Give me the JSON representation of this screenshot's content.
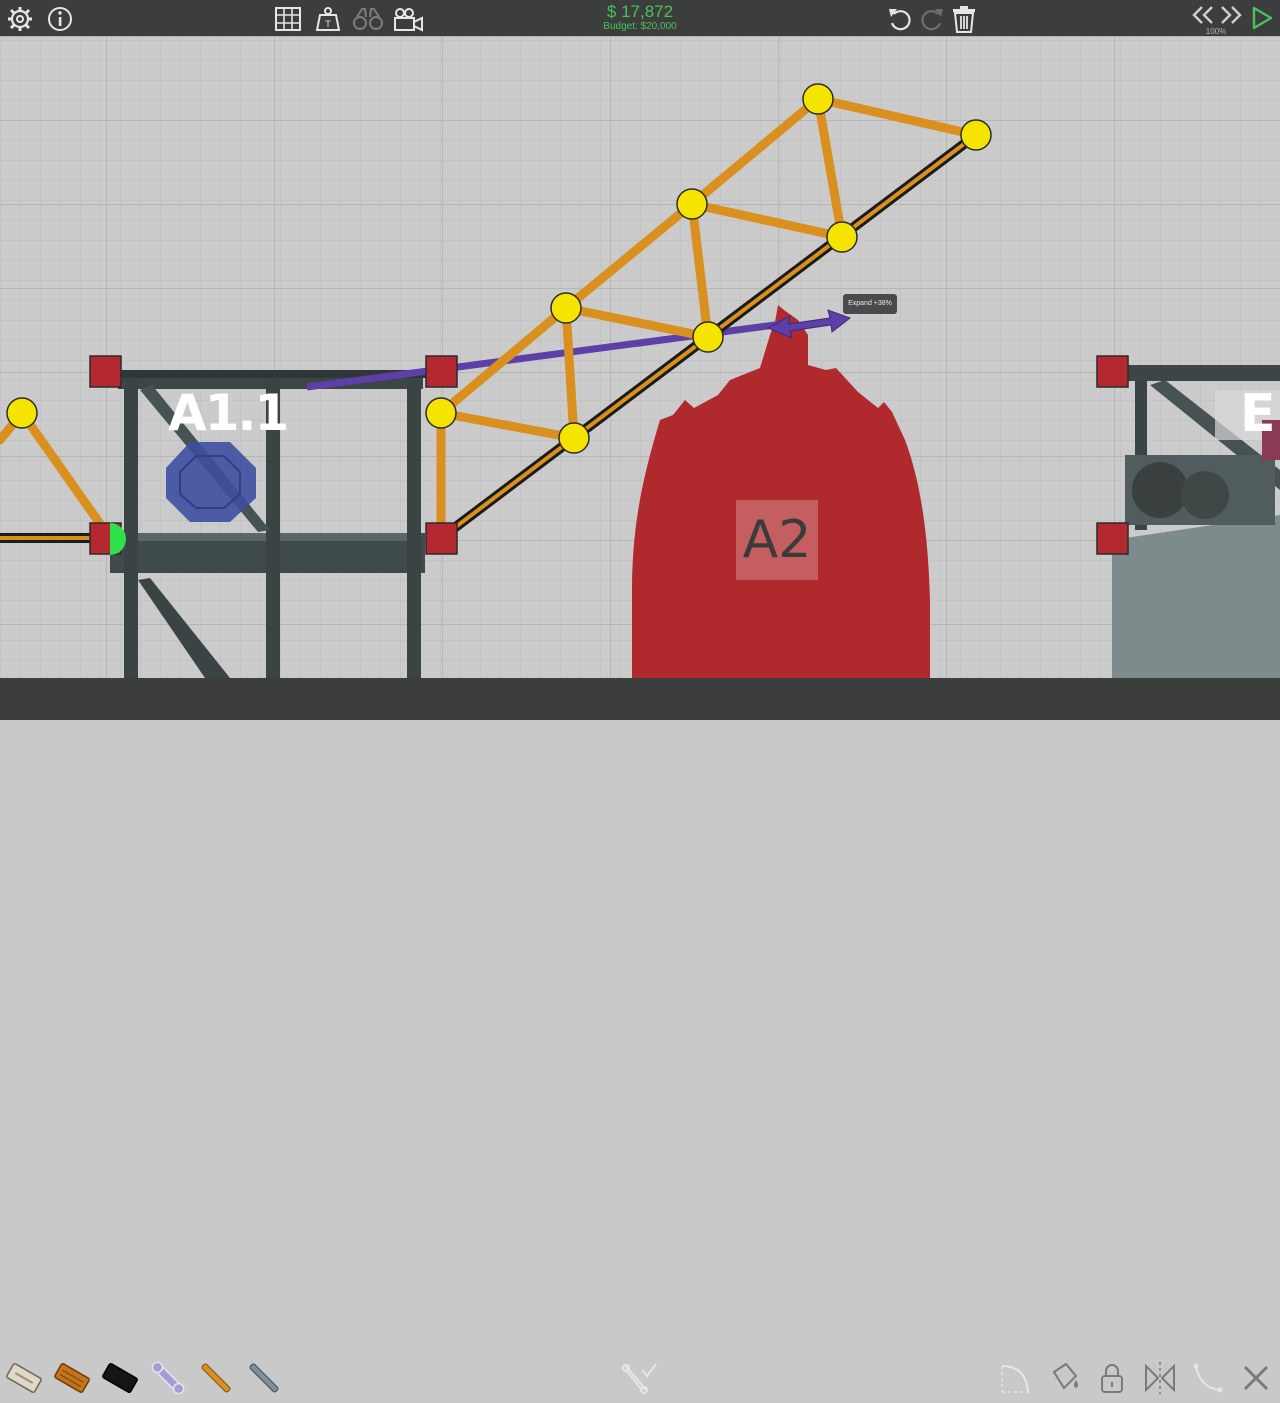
{
  "budget": {
    "cash": "$ 17,872",
    "limit": "Budget: $20,000"
  },
  "speed": {
    "label": "100%"
  },
  "zones": {
    "a11": "A1.1",
    "a2": "A2",
    "e": "E"
  },
  "tooltip": {
    "text": "Expand +38%"
  },
  "toolbar_top": {
    "left": [
      "settings-icon",
      "info-icon"
    ],
    "center": [
      "grid-icon",
      "weight-icon",
      "binoculars-icon",
      "camera-icon"
    ],
    "right": [
      "undo-icon",
      "redo-icon",
      "trash-icon",
      "rewind-icon",
      "fast-forward-icon",
      "play-icon"
    ]
  },
  "materials": [
    "road",
    "reinforced-road",
    "wood",
    "steel",
    "hydraulic",
    "rope",
    "cable"
  ],
  "bottom_right_tools": [
    "spline-icon",
    "paint-icon",
    "lock-icon",
    "mirror-icon",
    "arc-icon",
    "cancel-icon"
  ],
  "colors": {
    "wood": "#d9901e",
    "joint": "#f5e400",
    "anchor": "#b42830",
    "hydraulic": "#5e3fa8",
    "zone": "#b0292c",
    "cash": "#49c25a"
  }
}
